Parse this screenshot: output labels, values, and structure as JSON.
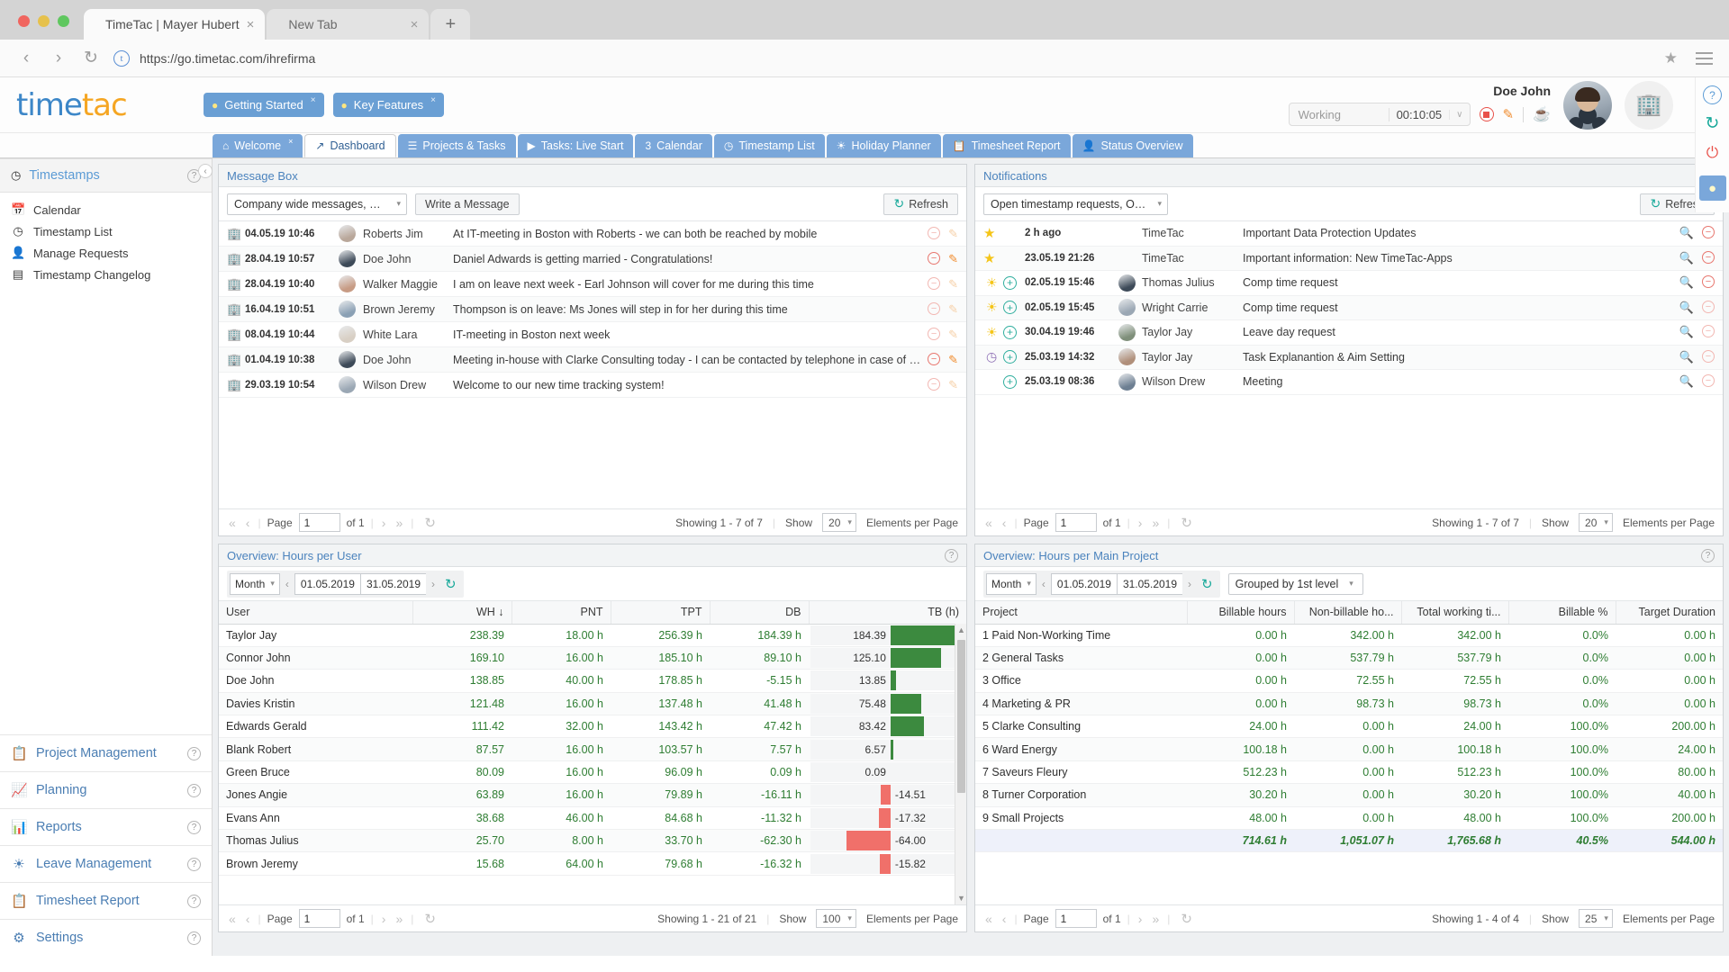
{
  "browser": {
    "tabs": [
      {
        "title": "TimeTac | Mayer Hubert",
        "close": "×"
      },
      {
        "title": "New Tab",
        "close": "×"
      }
    ],
    "new_tab_plus": "+",
    "url": "https://go.timetac.com/ihrefirma",
    "back_icon": "‹",
    "forward_icon": "›",
    "reload_icon": "↻",
    "site_icon_letter": "t",
    "bookmark_icon": "★",
    "menu_icon": "menu-icon"
  },
  "header": {
    "logo_part1": "time",
    "logo_part2": "tac",
    "hint_buttons": [
      {
        "label": "Getting Started",
        "close": "×"
      },
      {
        "label": "Key Features",
        "close": "×"
      }
    ],
    "user_name": "Doe John",
    "timer": {
      "state": "Working",
      "value": "00:10:05",
      "caret": "∨"
    },
    "stop_label": "stop-recording",
    "edit_icon": "✎",
    "break_icon": "☕",
    "company_icon": "🏢",
    "rail": {
      "help": "?",
      "refresh": "↻",
      "power": "⏻",
      "bulb": "💡"
    }
  },
  "app_tabs": [
    {
      "label": "Welcome",
      "icon": "⌂",
      "active": false,
      "closable": true
    },
    {
      "label": "Dashboard",
      "icon": "↗",
      "active": true,
      "closable": false
    },
    {
      "label": "Projects & Tasks",
      "icon": "☰",
      "active": false,
      "closable": false
    },
    {
      "label": "Tasks: Live Start",
      "icon": "▶",
      "active": false,
      "closable": false
    },
    {
      "label": "Calendar",
      "icon": "3",
      "active": false,
      "closable": false
    },
    {
      "label": "Timestamp List",
      "icon": "◷",
      "active": false,
      "closable": false
    },
    {
      "label": "Holiday Planner",
      "icon": "☀",
      "active": false,
      "closable": false
    },
    {
      "label": "Timesheet Report",
      "icon": "📋",
      "active": false,
      "closable": false
    },
    {
      "label": "Status Overview",
      "icon": "👤",
      "active": false,
      "closable": false
    }
  ],
  "sidebar": {
    "section_title": "Timestamps",
    "section_icon": "◷",
    "help_icon": "?",
    "collapse_icon": "‹",
    "items": [
      {
        "label": "Calendar",
        "icon": "📅"
      },
      {
        "label": "Timestamp List",
        "icon": "◷"
      },
      {
        "label": "Manage Requests",
        "icon": "👤"
      },
      {
        "label": "Timestamp Changelog",
        "icon": "▤"
      }
    ],
    "nav": [
      {
        "label": "Project Management",
        "icon": "📋"
      },
      {
        "label": "Planning",
        "icon": "📈"
      },
      {
        "label": "Reports",
        "icon": "📊"
      },
      {
        "label": "Leave Management",
        "icon": "☀"
      },
      {
        "label": "Timesheet Report",
        "icon": "📋"
      },
      {
        "label": "Settings",
        "icon": "⚙"
      }
    ]
  },
  "message_box": {
    "title": "Message Box",
    "help_icon": "?",
    "filter_value": "Company wide messages, Messages",
    "write_button": "Write a Message",
    "refresh_button": "Refresh",
    "rows": [
      {
        "date": "04.05.19 10:46",
        "name": "Roberts Jim",
        "text": "At IT-meeting in Boston with Roberts - we can both be reached by mobile",
        "edit_active": false
      },
      {
        "date": "28.04.19 10:57",
        "name": "Doe John",
        "text": "Daniel Adwards is getting married - Congratulations!",
        "edit_active": true
      },
      {
        "date": "28.04.19 10:40",
        "name": "Walker Maggie",
        "text": "I am on leave next week - Earl Johnson will cover for me during this time",
        "edit_active": false
      },
      {
        "date": "16.04.19 10:51",
        "name": "Brown Jeremy",
        "text": "Thompson is on leave: Ms Jones will step in for her during this time",
        "edit_active": false
      },
      {
        "date": "08.04.19 10:44",
        "name": "White Lara",
        "text": "IT-meeting in Boston next week",
        "edit_active": false
      },
      {
        "date": "01.04.19 10:38",
        "name": "Doe John",
        "text": "Meeting in-house with Clarke Consulting today - I can be contacted by telephone in case of emergency",
        "edit_active": true
      },
      {
        "date": "29.03.19 10:54",
        "name": "Wilson Drew",
        "text": "Welcome to our new time tracking system!",
        "edit_active": false
      }
    ],
    "pager": {
      "page_label": "Page",
      "page_value": "1",
      "of_label": "of 1",
      "showing": "Showing 1 - 7 of 7",
      "show_label": "Show",
      "page_size": "20",
      "per_page_label": "Elements per Page"
    }
  },
  "notifications": {
    "title": "Notifications",
    "help_icon": "?",
    "filter_value": "Open timestamp requests, Open leave",
    "refresh_button": "Refresh",
    "rows": [
      {
        "type": "star",
        "date": "2 h ago",
        "name": "TimeTac",
        "text": "Important Data Protection Updates",
        "has_plus": false,
        "has_avatar": false,
        "dim": false
      },
      {
        "type": "star",
        "date": "23.05.19 21:26",
        "name": "TimeTac",
        "text": "Important information: New TimeTac-Apps",
        "has_plus": false,
        "has_avatar": false,
        "dim": false
      },
      {
        "type": "sun",
        "date": "02.05.19 15:46",
        "name": "Thomas Julius",
        "text": "Comp time request",
        "has_plus": true,
        "has_avatar": true,
        "dim": false
      },
      {
        "type": "sun",
        "date": "02.05.19 15:45",
        "name": "Wright Carrie",
        "text": "Comp time request",
        "has_plus": true,
        "has_avatar": true,
        "dim": true
      },
      {
        "type": "sun",
        "date": "30.04.19 19:46",
        "name": "Taylor Jay",
        "text": "Leave day request",
        "has_plus": true,
        "has_avatar": true,
        "dim": true
      },
      {
        "type": "clock",
        "date": "25.03.19 14:32",
        "name": "Taylor Jay",
        "text": "Task Explanantion & Aim Setting",
        "has_plus": true,
        "has_avatar": true,
        "dim": true
      },
      {
        "type": "none",
        "date": "25.03.19 08:36",
        "name": "Wilson Drew",
        "text": "Meeting",
        "has_plus": true,
        "has_avatar": true,
        "dim": true
      }
    ],
    "pager": {
      "page_label": "Page",
      "page_value": "1",
      "of_label": "of 1",
      "showing": "Showing 1 - 7 of 7",
      "show_label": "Show",
      "page_size": "20",
      "per_page_label": "Elements per Page"
    }
  },
  "hours_per_user": {
    "title": "Overview: Hours per User",
    "help_icon": "?",
    "period": "Month",
    "date_from": "01.05.2019",
    "date_to": "31.05.2019",
    "columns": [
      "User",
      "WH",
      "PNT",
      "TPT",
      "DB",
      "TB (h)"
    ],
    "sort_col": "WH",
    "sort_dir": "↓",
    "pager": {
      "page_label": "Page",
      "page_value": "1",
      "of_label": "of 1",
      "showing": "Showing 1 - 21 of 21",
      "show_label": "Show",
      "page_size": "100",
      "per_page_label": "Elements per Page"
    },
    "chart_data": {
      "type": "table",
      "title": "Overview: Hours per User",
      "categories": [
        "Taylor Jay",
        "Connor John",
        "Doe John",
        "Davies Kristin",
        "Edwards Gerald",
        "Blank Robert",
        "Green Bruce",
        "Jones Angie",
        "Evans Ann",
        "Thomas Julius",
        "Brown Jeremy"
      ],
      "series": [
        {
          "name": "WH",
          "values": [
            238.39,
            169.1,
            138.85,
            121.48,
            111.42,
            87.57,
            80.09,
            63.89,
            38.68,
            25.7,
            15.68
          ]
        },
        {
          "name": "PNT",
          "values": [
            18.0,
            16.0,
            40.0,
            16.0,
            32.0,
            16.0,
            16.0,
            16.0,
            46.0,
            8.0,
            64.0
          ]
        },
        {
          "name": "TPT",
          "values": [
            256.39,
            185.1,
            178.85,
            137.48,
            143.42,
            103.57,
            96.09,
            79.89,
            84.68,
            33.7,
            79.68
          ]
        },
        {
          "name": "DB",
          "values": [
            184.39,
            89.1,
            -5.15,
            41.48,
            47.42,
            7.57,
            0.09,
            -16.11,
            -11.32,
            -62.3,
            -16.32
          ]
        },
        {
          "name": "TB",
          "values": [
            184.39,
            125.1,
            13.85,
            75.48,
            83.42,
            6.57,
            0.09,
            -14.51,
            -17.32,
            -64.0,
            -15.82
          ]
        }
      ]
    },
    "rows": [
      {
        "user": "Taylor Jay",
        "wh": "238.39",
        "pnt": "18.00 h",
        "tpt": "256.39 h",
        "db": "184.39 h",
        "db_neg": false,
        "tb": "184.39",
        "tb_val": 184.39
      },
      {
        "user": "Connor John",
        "wh": "169.10",
        "pnt": "16.00 h",
        "tpt": "185.10 h",
        "db": "89.10 h",
        "db_neg": false,
        "tb": "125.10",
        "tb_val": 125.1
      },
      {
        "user": "Doe John",
        "wh": "138.85",
        "pnt": "40.00 h",
        "tpt": "178.85 h",
        "db": "-5.15 h",
        "db_neg": true,
        "tb": "13.85",
        "tb_val": 13.85
      },
      {
        "user": "Davies Kristin",
        "wh": "121.48",
        "pnt": "16.00 h",
        "tpt": "137.48 h",
        "db": "41.48 h",
        "db_neg": false,
        "tb": "75.48",
        "tb_val": 75.48
      },
      {
        "user": "Edwards Gerald",
        "wh": "111.42",
        "pnt": "32.00 h",
        "tpt": "143.42 h",
        "db": "47.42 h",
        "db_neg": false,
        "tb": "83.42",
        "tb_val": 83.42
      },
      {
        "user": "Blank Robert",
        "wh": "87.57",
        "pnt": "16.00 h",
        "tpt": "103.57 h",
        "db": "7.57 h",
        "db_neg": false,
        "tb": "6.57",
        "tb_val": 6.57
      },
      {
        "user": "Green Bruce",
        "wh": "80.09",
        "pnt": "16.00 h",
        "tpt": "96.09 h",
        "db": "0.09 h",
        "db_neg": false,
        "tb": "0.09",
        "tb_val": 0.09
      },
      {
        "user": "Jones Angie",
        "wh": "63.89",
        "pnt": "16.00 h",
        "tpt": "79.89 h",
        "db": "-16.11 h",
        "db_neg": true,
        "tb": "-14.51",
        "tb_val": -14.51
      },
      {
        "user": "Evans Ann",
        "wh": "38.68",
        "pnt": "46.00 h",
        "tpt": "84.68 h",
        "db": "-11.32 h",
        "db_neg": true,
        "tb": "-17.32",
        "tb_val": -17.32
      },
      {
        "user": "Thomas Julius",
        "wh": "25.70",
        "pnt": "8.00 h",
        "tpt": "33.70 h",
        "db": "-62.30 h",
        "db_neg": true,
        "tb": "-64.00",
        "tb_val": -64.0
      },
      {
        "user": "Brown Jeremy",
        "wh": "15.68",
        "pnt": "64.00 h",
        "tpt": "79.68 h",
        "db": "-16.32 h",
        "db_neg": true,
        "tb": "-15.82",
        "tb_val": -15.82
      }
    ]
  },
  "hours_per_project": {
    "title": "Overview: Hours per Main Project",
    "help_icon": "?",
    "period": "Month",
    "date_from": "01.05.2019",
    "date_to": "31.05.2019",
    "grouping": "Grouped by 1st level",
    "columns": [
      "Project",
      "Billable hours",
      "Non-billable ho...",
      "Total working ti...",
      "Billable %",
      "Target Duration"
    ],
    "pager": {
      "page_label": "Page",
      "page_value": "1",
      "of_label": "of 1",
      "showing": "Showing 1 - 4 of 4",
      "show_label": "Show",
      "page_size": "25",
      "per_page_label": "Elements per Page"
    },
    "chart_data": {
      "type": "table",
      "title": "Overview: Hours per Main Project",
      "categories": [
        "1 Paid Non-Working Time",
        "2 General Tasks",
        "3 Office",
        "4 Marketing & PR",
        "5 Clarke Consulting",
        "6 Ward Energy",
        "7 Saveurs Fleury",
        "8 Turner Corporation",
        "9 Small Projects"
      ],
      "series": [
        {
          "name": "Billable hours",
          "values": [
            0.0,
            0.0,
            0.0,
            0.0,
            24.0,
            100.18,
            512.23,
            30.2,
            48.0
          ]
        },
        {
          "name": "Non-billable hours",
          "values": [
            342.0,
            537.79,
            72.55,
            98.73,
            0.0,
            0.0,
            0.0,
            0.0,
            0.0
          ]
        },
        {
          "name": "Total working time",
          "values": [
            342.0,
            537.79,
            72.55,
            98.73,
            24.0,
            100.18,
            512.23,
            30.2,
            48.0
          ]
        },
        {
          "name": "Billable %",
          "values": [
            0.0,
            0.0,
            0.0,
            0.0,
            100.0,
            100.0,
            100.0,
            100.0,
            100.0
          ]
        },
        {
          "name": "Target Duration",
          "values": [
            0.0,
            0.0,
            0.0,
            0.0,
            200.0,
            24.0,
            80.0,
            40.0,
            200.0
          ]
        }
      ],
      "totals": {
        "billable": 714.61,
        "non_billable": 1051.07,
        "total": 1765.68,
        "billable_pct": 40.5,
        "target": 544.0
      }
    },
    "rows": [
      {
        "project": "1 Paid Non-Working Time",
        "billable": "0.00 h",
        "nonbillable": "342.00 h",
        "total": "342.00 h",
        "pct": "0.0%",
        "target": "0.00 h"
      },
      {
        "project": "2 General Tasks",
        "billable": "0.00 h",
        "nonbillable": "537.79 h",
        "total": "537.79 h",
        "pct": "0.0%",
        "target": "0.00 h"
      },
      {
        "project": "3 Office",
        "billable": "0.00 h",
        "nonbillable": "72.55 h",
        "total": "72.55 h",
        "pct": "0.0%",
        "target": "0.00 h"
      },
      {
        "project": "4 Marketing & PR",
        "billable": "0.00 h",
        "nonbillable": "98.73 h",
        "total": "98.73 h",
        "pct": "0.0%",
        "target": "0.00 h"
      },
      {
        "project": "5 Clarke Consulting",
        "billable": "24.00 h",
        "nonbillable": "0.00 h",
        "total": "24.00 h",
        "pct": "100.0%",
        "target": "200.00 h"
      },
      {
        "project": "6 Ward Energy",
        "billable": "100.18 h",
        "nonbillable": "0.00 h",
        "total": "100.18 h",
        "pct": "100.0%",
        "target": "24.00 h"
      },
      {
        "project": "7 Saveurs Fleury",
        "billable": "512.23 h",
        "nonbillable": "0.00 h",
        "total": "512.23 h",
        "pct": "100.0%",
        "target": "80.00 h"
      },
      {
        "project": "8 Turner Corporation",
        "billable": "30.20 h",
        "nonbillable": "0.00 h",
        "total": "30.20 h",
        "pct": "100.0%",
        "target": "40.00 h"
      },
      {
        "project": "9 Small Projects",
        "billable": "48.00 h",
        "nonbillable": "0.00 h",
        "total": "48.00 h",
        "pct": "100.0%",
        "target": "200.00 h"
      }
    ],
    "totals_row": {
      "project": "",
      "billable": "714.61 h",
      "nonbillable": "1,051.07 h",
      "total": "1,765.68 h",
      "pct": "40.5%",
      "target": "544.00 h"
    }
  }
}
